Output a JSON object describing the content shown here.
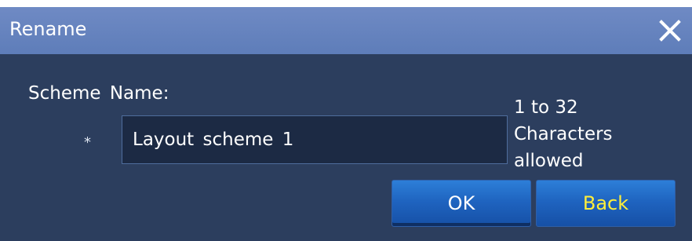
{
  "window": {
    "title": "Rename",
    "close_icon": "close-icon"
  },
  "form": {
    "field_label": "Scheme Name:",
    "required_marker": "*",
    "scheme_name_value": "Layout scheme 1",
    "hint_lines": [
      "1 to 32",
      "Characters",
      "allowed"
    ]
  },
  "buttons": {
    "ok_label": "OK",
    "back_label": "Back"
  },
  "colors": {
    "titlebar": "#6683bf",
    "dialog_bg": "#2c3e5e",
    "input_bg": "#1c2a44",
    "button_blue": "#1f64c0",
    "back_text": "#ffef3a"
  }
}
